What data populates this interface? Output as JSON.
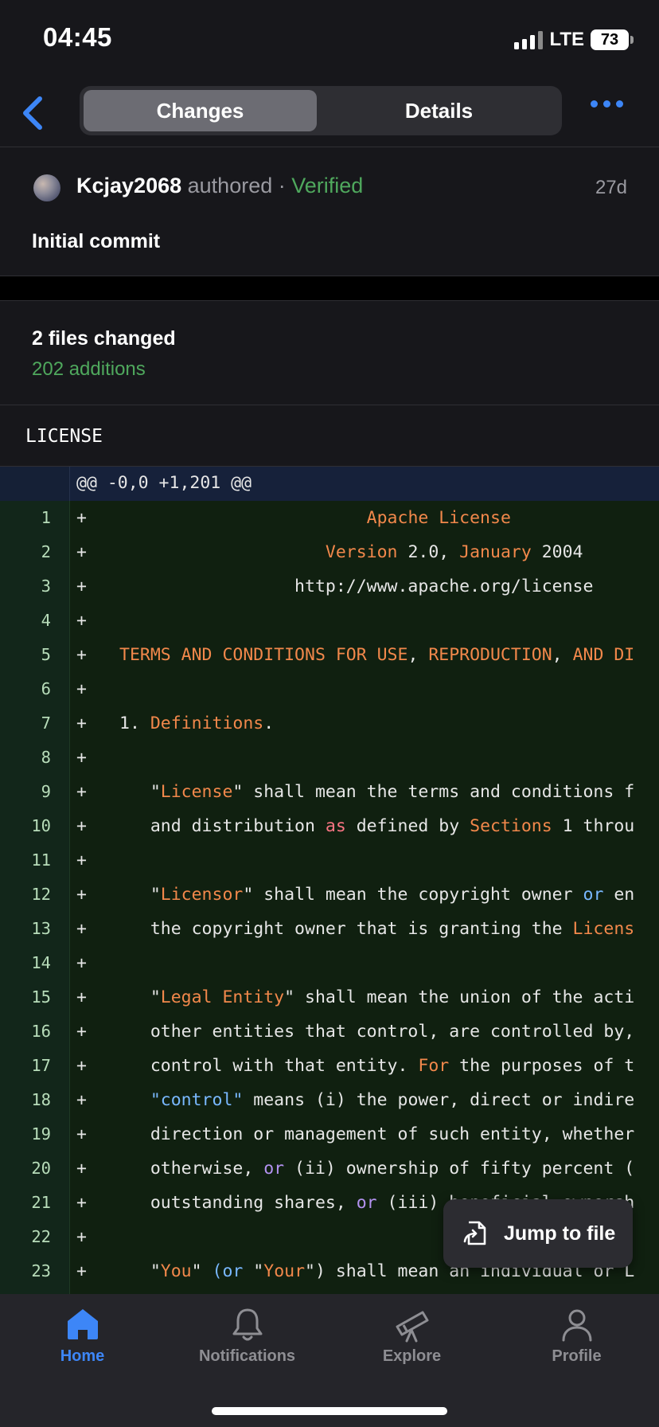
{
  "status": {
    "time": "04:45",
    "network": "LTE",
    "battery": "73"
  },
  "nav": {
    "tabs": [
      "Changes",
      "Details"
    ],
    "active_tab": "Changes"
  },
  "commit": {
    "author": "Kcjay2068",
    "authored": "authored",
    "separator": "·",
    "verified": "Verified",
    "age": "27d",
    "message": "Initial commit"
  },
  "summary": {
    "files_changed": "2 files changed",
    "additions": "202 additions"
  },
  "file": {
    "name": "LICENSE",
    "hunk": "@@ -0,0 +1,201 @@"
  },
  "diff_lines": [
    {
      "num": "1",
      "tokens": [
        {
          "t": "                        ",
          "c": "n"
        },
        {
          "t": "Apache License",
          "c": "o"
        }
      ]
    },
    {
      "num": "2",
      "tokens": [
        {
          "t": "                    ",
          "c": "n"
        },
        {
          "t": "Version",
          "c": "o"
        },
        {
          "t": " 2.0, ",
          "c": "n"
        },
        {
          "t": "January",
          "c": "o"
        },
        {
          "t": " 2004",
          "c": "n"
        }
      ]
    },
    {
      "num": "3",
      "tokens": [
        {
          "t": "                 http://www.apache.org/license",
          "c": "n"
        }
      ]
    },
    {
      "num": "4",
      "tokens": []
    },
    {
      "num": "5",
      "tokens": [
        {
          "t": "TERMS AND CONDITIONS FOR USE",
          "c": "o"
        },
        {
          "t": ", ",
          "c": "n"
        },
        {
          "t": "REPRODUCTION",
          "c": "o"
        },
        {
          "t": ", ",
          "c": "n"
        },
        {
          "t": "AND DI",
          "c": "o"
        }
      ]
    },
    {
      "num": "6",
      "tokens": []
    },
    {
      "num": "7",
      "tokens": [
        {
          "t": "1. ",
          "c": "n"
        },
        {
          "t": "Definitions",
          "c": "o"
        },
        {
          "t": ".",
          "c": "n"
        }
      ]
    },
    {
      "num": "8",
      "tokens": []
    },
    {
      "num": "9",
      "tokens": [
        {
          "t": "   \"",
          "c": "n"
        },
        {
          "t": "License",
          "c": "o"
        },
        {
          "t": "\" shall mean the terms and conditions f",
          "c": "n"
        }
      ]
    },
    {
      "num": "10",
      "tokens": [
        {
          "t": "   and distribution ",
          "c": "n"
        },
        {
          "t": "as",
          "c": "r"
        },
        {
          "t": " defined by ",
          "c": "n"
        },
        {
          "t": "Sections",
          "c": "o"
        },
        {
          "t": " 1 throu",
          "c": "n"
        }
      ]
    },
    {
      "num": "11",
      "tokens": []
    },
    {
      "num": "12",
      "tokens": [
        {
          "t": "   \"",
          "c": "n"
        },
        {
          "t": "Licensor",
          "c": "o"
        },
        {
          "t": "\" shall mean the copyright owner ",
          "c": "n"
        },
        {
          "t": "or",
          "c": "b"
        },
        {
          "t": " en",
          "c": "n"
        }
      ]
    },
    {
      "num": "13",
      "tokens": [
        {
          "t": "   the copyright owner that is granting the ",
          "c": "n"
        },
        {
          "t": "Licens",
          "c": "o"
        }
      ]
    },
    {
      "num": "14",
      "tokens": []
    },
    {
      "num": "15",
      "tokens": [
        {
          "t": "   \"",
          "c": "n"
        },
        {
          "t": "Legal Entity",
          "c": "o"
        },
        {
          "t": "\" shall mean the union of the acti",
          "c": "n"
        }
      ]
    },
    {
      "num": "16",
      "tokens": [
        {
          "t": "   other entities that control, are controlled by,",
          "c": "n"
        }
      ]
    },
    {
      "num": "17",
      "tokens": [
        {
          "t": "   control with that entity. ",
          "c": "n"
        },
        {
          "t": "For",
          "c": "o"
        },
        {
          "t": " the purposes of t",
          "c": "n"
        }
      ]
    },
    {
      "num": "18",
      "tokens": [
        {
          "t": "   \"control\"",
          "c": "b"
        },
        {
          "t": " means (i) the power, direct or indire",
          "c": "n"
        }
      ]
    },
    {
      "num": "19",
      "tokens": [
        {
          "t": "   direction or management of such entity, whether",
          "c": "n"
        }
      ]
    },
    {
      "num": "20",
      "tokens": [
        {
          "t": "   otherwise, ",
          "c": "n"
        },
        {
          "t": "or",
          "c": "p"
        },
        {
          "t": " (ii) ownership of fifty percent (",
          "c": "n"
        }
      ]
    },
    {
      "num": "21",
      "tokens": [
        {
          "t": "   outstanding shares, ",
          "c": "n"
        },
        {
          "t": "or",
          "c": "p"
        },
        {
          "t": " (iii) beneficial ownersh",
          "c": "n"
        }
      ]
    },
    {
      "num": "22",
      "tokens": []
    },
    {
      "num": "23",
      "tokens": [
        {
          "t": "   \"",
          "c": "n"
        },
        {
          "t": "You",
          "c": "o"
        },
        {
          "t": "\" ",
          "c": "n"
        },
        {
          "t": "(or",
          "c": "b"
        },
        {
          "t": " \"",
          "c": "n"
        },
        {
          "t": "Your",
          "c": "o"
        },
        {
          "t": "\") shall mean an individual or L",
          "c": "n"
        }
      ]
    }
  ],
  "diff_plus": "+",
  "jump_to_file": "Jump to file",
  "tabbar": [
    {
      "label": "Home",
      "icon": "house-icon",
      "active": true
    },
    {
      "label": "Notifications",
      "icon": "bell-icon",
      "active": false
    },
    {
      "label": "Explore",
      "icon": "telescope-icon",
      "active": false
    },
    {
      "label": "Profile",
      "icon": "person-icon",
      "active": false
    }
  ],
  "colors": {
    "accent": "#3d86f7",
    "verified": "#4fa85d",
    "syntax_orange": "#f2884b",
    "syntax_blue": "#79b8ff",
    "syntax_purple": "#b392f0",
    "syntax_red": "#f97583"
  }
}
